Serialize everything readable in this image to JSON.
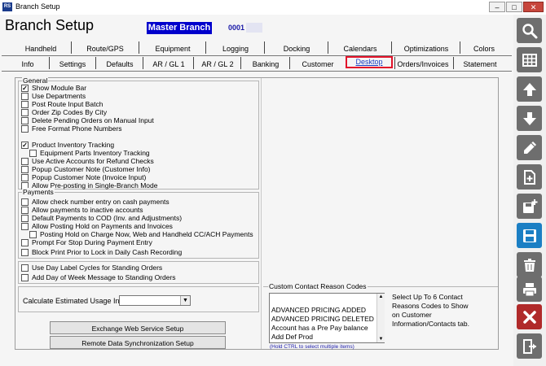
{
  "window": {
    "title": "Branch Setup",
    "minimize": "–",
    "maximize": "□",
    "close": "✕"
  },
  "header": {
    "title": "Branch Setup",
    "branch_name": "Master Branch",
    "branch_code": "0001"
  },
  "tabs_row1": [
    "Handheld",
    "Route/GPS",
    "Equipment",
    "Logging",
    "Docking",
    "Calendars",
    "Optimizations",
    "Colors"
  ],
  "tabs_row2": [
    "Info",
    "Settings",
    "Defaults",
    "AR / GL 1",
    "AR / GL 2",
    "Banking",
    "Customer",
    "Desktop",
    "Orders/Invoices",
    "Statement"
  ],
  "active_tab": "Desktop",
  "general": {
    "label": "General",
    "items": [
      {
        "label": "Show Module Bar",
        "checked": true
      },
      {
        "label": "Use Departments",
        "checked": false
      },
      {
        "label": "Post Route Input Batch",
        "checked": false
      },
      {
        "label": "Order Zip Codes By City",
        "checked": false
      },
      {
        "label": "Delete Pending Orders on Manual Input",
        "checked": false
      },
      {
        "label": "Free Format Phone Numbers",
        "checked": false
      },
      {
        "label": "Product Inventory Tracking",
        "checked": true
      },
      {
        "label": "Equipment Parts Inventory Tracking",
        "checked": false
      },
      {
        "label": "Use Active Accounts for Refund Checks",
        "checked": false
      },
      {
        "label": "Popup Customer Note (Customer Info)",
        "checked": false
      },
      {
        "label": "Popup Customer Note (Invoice Input)",
        "checked": false
      },
      {
        "label": "Allow Pre-posting in Single-Branch Mode",
        "checked": false
      }
    ]
  },
  "payments": {
    "label": "Payments",
    "items": [
      {
        "label": "Allow check number entry on cash payments",
        "checked": false
      },
      {
        "label": "Allow payments to inactive accounts",
        "checked": false
      },
      {
        "label": "Default Payments to COD (Inv. and Adjustments)",
        "checked": false
      },
      {
        "label": "Allow Posting Hold on Payments and Invoices",
        "checked": false
      },
      {
        "label": "Posting Hold on Charge Now, Web and Handheld CC/ACH Payments",
        "checked": false
      },
      {
        "label": "Prompt For Stop During Payment Entry",
        "checked": false
      },
      {
        "label": "Block Print Prior to Lock in Daily Cash Recording",
        "checked": false
      }
    ]
  },
  "standing_orders": [
    {
      "label": "Use Day Label Cycles for Standing Orders",
      "checked": false
    },
    {
      "label": "Add Day of Week Message to Standing Orders",
      "checked": false
    }
  ],
  "calc_usage": {
    "label": "Calculate Estimated Usage In",
    "value": ""
  },
  "buttons": {
    "exchange": "Exchange Web Service Setup",
    "remote": "Remote Data Synchronization Setup"
  },
  "contact_reasons": {
    "label": "Custom Contact Reason Codes",
    "items": [
      "ADVANCED PRICING ADDED",
      "ADVANCED PRICING DELETED",
      "Account has a Pre Pay balance",
      "Add Def Prod"
    ],
    "hint": "(Hold CTRL to select multiple items)",
    "help": "Select Up To 6 Contact Reasons Codes to Show on Customer Information/Contacts tab."
  },
  "toolbar": [
    "search-icon",
    "grid-icon",
    "up-arrow-icon",
    "down-arrow-icon",
    "pencil-icon",
    "new-document-icon",
    "new-record-icon",
    "save-icon",
    "delete-icon",
    "print-icon",
    "cancel-icon",
    "exit-icon"
  ],
  "colors": {
    "accent_blue": "#0000cc",
    "tab_highlight": "#e2132a",
    "toolbar_button": "#6e6e6e",
    "save_button": "#1b7fc4",
    "cancel_button": "#b02a2a"
  }
}
